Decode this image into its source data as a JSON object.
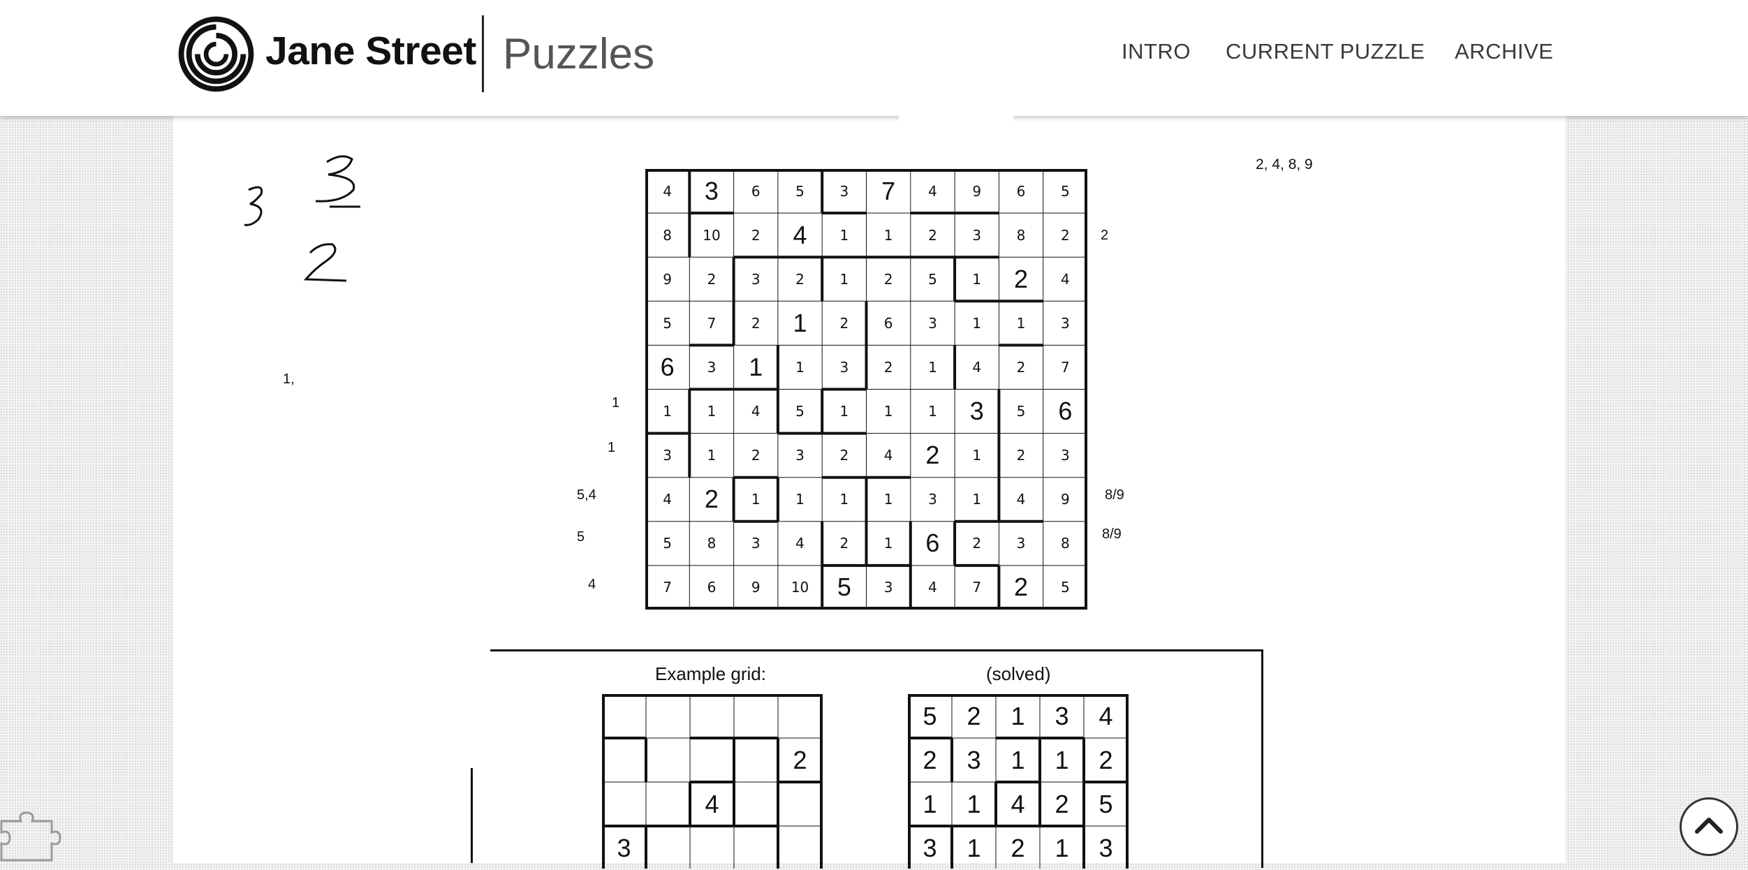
{
  "header": {
    "brand_name": "Jane Street",
    "brand_sub": "Puzzles",
    "nav": [
      "INTRO",
      "CURRENT PUZZLE",
      "ARCHIVE"
    ]
  },
  "side_notes": {
    "hint_top_right": "2, 4, 8, 9",
    "note_left": "1,",
    "right_labels": [
      "2",
      "8/9",
      "8/9"
    ],
    "left_labels": [
      "1",
      "1",
      "5,4",
      "5",
      "4"
    ],
    "handwritten": [
      "3",
      "3",
      "2"
    ]
  },
  "main_grid": {
    "values": [
      [
        "4",
        "3",
        "6",
        "5",
        "3",
        "7",
        "4",
        "9",
        "6",
        "5"
      ],
      [
        "8",
        "10",
        "2",
        "4",
        "1",
        "1",
        "2",
        "3",
        "8",
        "2"
      ],
      [
        "9",
        "2",
        "3",
        "2",
        "1",
        "2",
        "5",
        "1",
        "2",
        "4"
      ],
      [
        "5",
        "7",
        "2",
        "1",
        "2",
        "6",
        "3",
        "1",
        "1",
        "3"
      ],
      [
        "6",
        "3",
        "1",
        "1",
        "3",
        "2",
        "1",
        "4",
        "2",
        "7"
      ],
      [
        "1",
        "1",
        "4",
        "5",
        "1",
        "1",
        "1",
        "3",
        "5",
        "6"
      ],
      [
        "3",
        "1",
        "2",
        "3",
        "2",
        "4",
        "2",
        "1",
        "2",
        "3"
      ],
      [
        "4",
        "2",
        "1",
        "1",
        "1",
        "1",
        "3",
        "1",
        "4",
        "9"
      ],
      [
        "5",
        "8",
        "3",
        "4",
        "2",
        "1",
        "6",
        "2",
        "3",
        "8"
      ],
      [
        "7",
        "6",
        "9",
        "10",
        "5",
        "3",
        "4",
        "7",
        "2",
        "5"
      ]
    ],
    "given_clues": [
      "3",
      "7",
      "4",
      "2",
      "1",
      "1",
      "6",
      "3",
      "6",
      "2",
      "2",
      "6",
      "5",
      "2"
    ]
  },
  "example": {
    "title": "Example grid:",
    "solved_title": "(solved)",
    "unsolved_visible": [
      [
        "",
        "",
        "",
        "",
        ""
      ],
      [
        "",
        "",
        "",
        "",
        "2"
      ],
      [
        "",
        "",
        "4",
        "",
        ""
      ],
      [
        "3",
        "",
        "",
        "",
        ""
      ]
    ],
    "solved_visible": [
      [
        "5",
        "2",
        "1",
        "3",
        "4"
      ],
      [
        "2",
        "3",
        "1",
        "1",
        "2"
      ],
      [
        "1",
        "1",
        "4",
        "2",
        "5"
      ],
      [
        "3",
        "1",
        "2",
        "1",
        "3"
      ]
    ]
  },
  "icons": {
    "logo": "jane-street-logo-icon",
    "puzzle": "puzzle-piece-icon",
    "scroll_top": "chevron-up-icon"
  }
}
